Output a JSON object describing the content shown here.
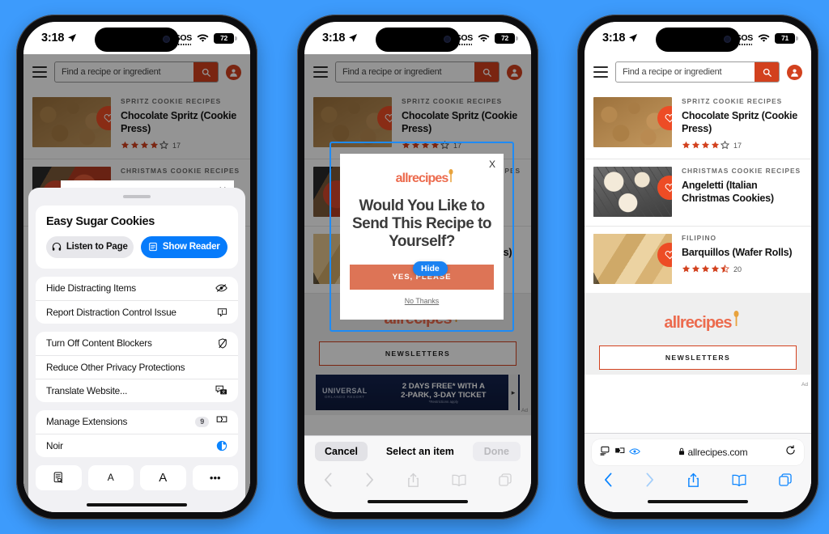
{
  "meta": {
    "background_color": "#3d9bfc",
    "accent_blue": "#067bfb",
    "brand_orange": "#d2411e"
  },
  "status_bar": {
    "time": "3:18",
    "sos_label": "SOS",
    "battery_p1": "72",
    "battery_p2": "72",
    "battery_p3": "71"
  },
  "site": {
    "logo_text": "allrecipes",
    "search_placeholder": "Find a recipe or ingredient",
    "newsletters_label": "NEWSLETTERS",
    "ad_label": "Ad"
  },
  "recipes": [
    {
      "category": "SPRITZ COOKIE RECIPES",
      "title": "Chocolate Spritz (Cookie Press)",
      "stars": 4,
      "half": false,
      "count": "17"
    },
    {
      "category": "CHRISTMAS COOKIE RECIPES",
      "title": "Angeletti (Italian Christmas Cookies)",
      "stars": 0,
      "half": false,
      "count": ""
    },
    {
      "category": "FILIPINO",
      "title": "Barquillos (Wafer Rolls)",
      "stars": 4,
      "half": true,
      "count": "20"
    }
  ],
  "ad": {
    "brand": "UNIVERSAL",
    "brand_sub": "ORLANDO RESORT",
    "line1": "2 DAYS FREE* WITH A",
    "line2": "2-PARK, 3-DAY TICKET",
    "fineprint": "*Restrictions apply"
  },
  "allrecipes_modal": {
    "close_label": "X",
    "logo_text": "allrecipes",
    "headline": "Would You Like to Send This Recipe to Yourself?",
    "cta_label": "YES, PLEASE",
    "decline_label": "No Thanks"
  },
  "hide_popover": {
    "label": "Hide"
  },
  "page_menu": {
    "page_title": "Easy Sugar Cookies",
    "listen_label": "Listen to Page",
    "reader_label": "Show Reader",
    "group_a": [
      {
        "label": "Hide Distracting Items",
        "icon": "eye-slash-icon",
        "badge": ""
      },
      {
        "label": "Report Distraction Control Issue",
        "icon": "exclamation-bubble-icon",
        "badge": ""
      }
    ],
    "group_b": [
      {
        "label": "Turn Off Content Blockers",
        "icon": "shield-slash-icon",
        "badge": ""
      },
      {
        "label": "Reduce Other Privacy Protections",
        "icon": "",
        "badge": ""
      },
      {
        "label": "Translate Website...",
        "icon": "translate-icon",
        "badge": ""
      }
    ],
    "group_c": [
      {
        "label": "Manage Extensions",
        "icon": "puzzle-icon",
        "badge": "9"
      },
      {
        "label": "Noir",
        "icon": "noir-icon",
        "badge": ""
      }
    ],
    "tools": [
      {
        "name": "find-on-page-icon",
        "label": ""
      },
      {
        "name": "text-size-decrease",
        "label": "A"
      },
      {
        "name": "text-size-increase",
        "label": "A"
      },
      {
        "name": "more-options-icon",
        "label": "•••"
      }
    ]
  },
  "accessory_bar": {
    "cancel_label": "Cancel",
    "title": "Select an item",
    "done_label": "Done"
  },
  "address_bar": {
    "url": "allrecipes.com",
    "lock_icon": "lock-icon",
    "reload_icon": "reload-icon",
    "page_settings_icon": "page-settings-icon",
    "extension_icon": "extension-icon",
    "noir_icon": "noir-eye-icon"
  },
  "tabbar": {
    "back": "back-chevron-icon",
    "forward": "forward-chevron-icon",
    "share": "share-icon",
    "bookmarks": "bookmarks-icon",
    "tabs": "tabs-icon"
  }
}
